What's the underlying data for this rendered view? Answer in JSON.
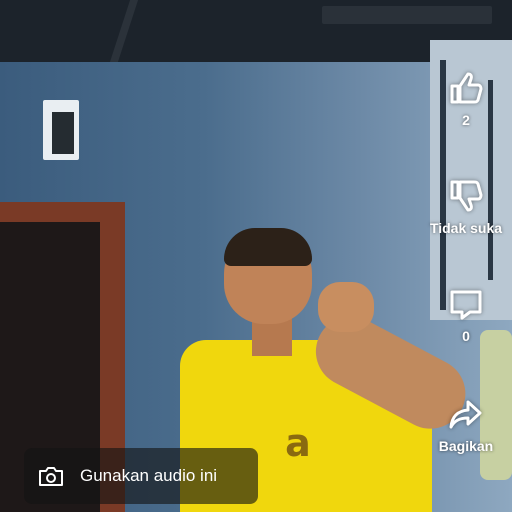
{
  "actions": {
    "like": {
      "icon": "thumbs-up-icon",
      "count": "2"
    },
    "dislike": {
      "icon": "thumbs-down-icon",
      "label": "Tidak suka"
    },
    "comment": {
      "icon": "comment-icon",
      "count": "0"
    },
    "share": {
      "icon": "share-icon",
      "label": "Bagikan"
    }
  },
  "audio": {
    "icon": "camera-icon",
    "label": "Gunakan audio ini"
  },
  "colors": {
    "shirt": "#f0d70d",
    "wall": "#4b6d8d",
    "overlay_text": "#ffffff"
  }
}
